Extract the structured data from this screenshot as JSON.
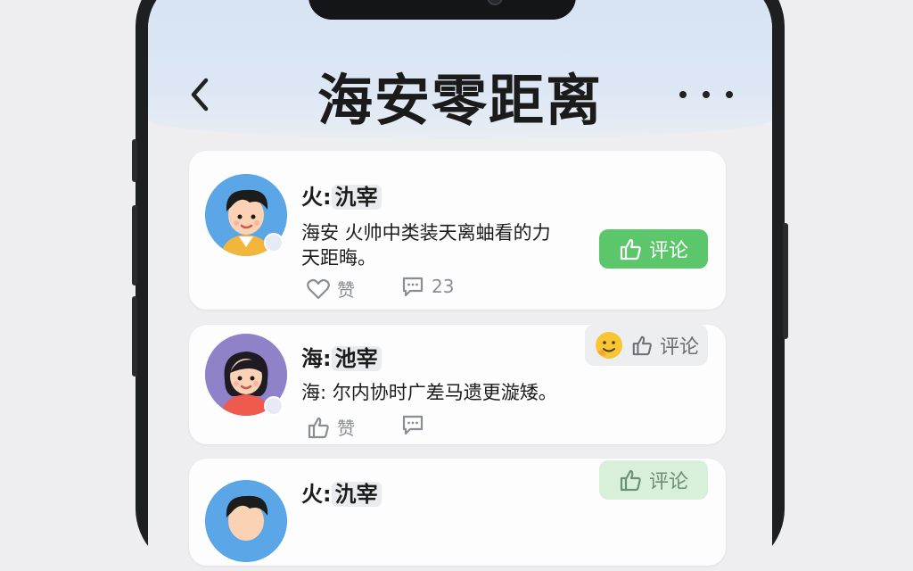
{
  "app": {
    "title": "海安零距离",
    "back_icon": "chevron-left-icon",
    "more_icon": "more-horizontal-icon"
  },
  "posts": [
    {
      "author": "火:",
      "author_tag": "氿宰",
      "text_lines": [
        "海安  火帅中类装天离蚰看的力",
        "天距晦。"
      ],
      "like_label": "赞",
      "comment_count": "23",
      "comment_button_label": "评论",
      "comment_button_style": "green"
    },
    {
      "author": "海:",
      "author_tag": "池宰",
      "text_lines": [
        "海: 尔内协时广差马遗更漩矮。"
      ],
      "like_label": "赞",
      "comment_count": "",
      "comment_button_label": "评论",
      "comment_button_style": "gray-with-emoji"
    },
    {
      "author": "火:",
      "author_tag": "氿宰",
      "text_lines": [],
      "comment_button_label": "评论",
      "comment_button_style": "light-green"
    }
  ],
  "colors": {
    "header_bg": "#d6e2f3",
    "green_button": "#5cc66a",
    "light_green_button": "#d8f0da",
    "gray_button": "#eceef0"
  }
}
